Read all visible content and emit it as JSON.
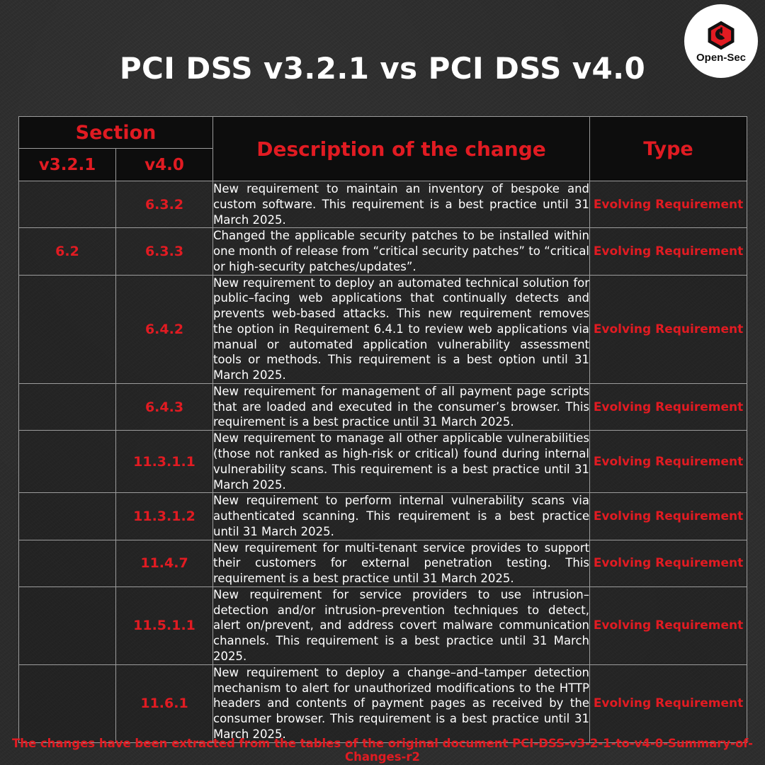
{
  "brand": {
    "logo_text": "Open-Sec",
    "logo_icon": "hexagon-shield-logo",
    "accent_color": "#e11b22",
    "background_color": "#2b2b2b"
  },
  "title": "PCI DSS v3.2.1 vs PCI DSS v4.0",
  "table": {
    "headers": {
      "section": "Section",
      "v321": "v3.2.1",
      "v40": "v4.0",
      "description": "Description of the change",
      "type": "Type"
    },
    "rows": [
      {
        "v321": "",
        "v40": "6.3.2",
        "description": "New requirement to maintain an inventory of bespoke and custom software. This requirement is a best practice until 31 March 2025.",
        "type": "Evolving Requirement"
      },
      {
        "v321": "6.2",
        "v40": "6.3.3",
        "description": "Changed the applicable security patches to be installed within one month of release from “critical security patches” to “critical or high-security patches/updates”.",
        "type": "Evolving Requirement"
      },
      {
        "v321": "",
        "v40": "6.4.2",
        "description": "New requirement to deploy an automated technical solution for public–facing web applications that continually detects and prevents web-based attacks. This new requirement removes the option in Requirement 6.4.1 to review web applications via manual or automated application vulnerability assessment tools or methods. This requirement is a best option until 31 March 2025.",
        "type": "Evolving Requirement"
      },
      {
        "v321": "",
        "v40": "6.4.3",
        "description": "New requirement for management of all payment page scripts that are loaded and executed in the consumer’s browser. This requirement is a best practice until 31 March 2025.",
        "type": "Evolving Requirement"
      },
      {
        "v321": "",
        "v40": "11.3.1.1",
        "description": "New requirement to manage all other applicable vulnerabilities (those not ranked as high-risk or critical) found during internal vulnerability scans. This requirement is a best practice until 31 March 2025.",
        "type": "Evolving Requirement"
      },
      {
        "v321": "",
        "v40": "11.3.1.2",
        "description": "New requirement to perform internal vulnerability scans via authenticated scanning. This requirement is a best practice until 31 March 2025.",
        "type": "Evolving Requirement"
      },
      {
        "v321": "",
        "v40": "11.4.7",
        "description": "New requirement for multi-tenant service provides to support their customers for external penetration testing. This requirement is a best practice until 31 March 2025.",
        "type": "Evolving Requirement"
      },
      {
        "v321": "",
        "v40": "11.5.1.1",
        "description": "New requirement for service providers to use intrusion–detection and/or intrusion–prevention techniques to detect, alert on/prevent, and address covert malware communication channels. This requirement is a best practice until 31 March 2025.",
        "type": "Evolving Requirement"
      },
      {
        "v321": "",
        "v40": "11.6.1",
        "description": "New requirement to deploy a change–and–tamper detection mechanism to alert for unauthorized modifications to the HTTP headers and contents of payment pages as received by the consumer browser. This requirement is a best practice until 31 March 2025.",
        "type": "Evolving Requirement"
      }
    ]
  },
  "footer": "The changes have been extracted from the tables of the original document PCI-DSS-v3-2-1-to-v4-0-Summary-of-Changes-r2"
}
